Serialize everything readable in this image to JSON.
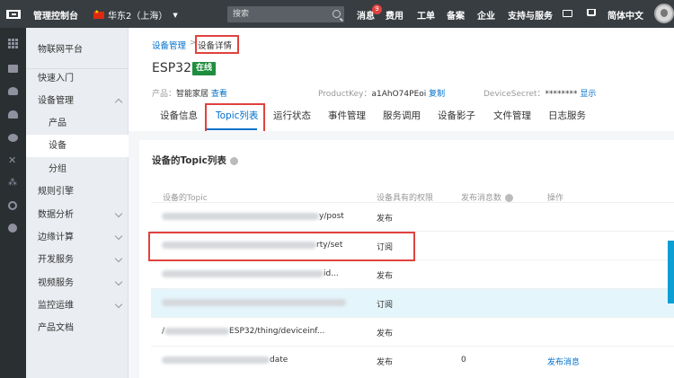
{
  "topbar": {
    "console_title": "管理控制台",
    "region": "华东2（上海）",
    "search_placeholder": "搜索",
    "messages_label": "消息",
    "messages_count": "9",
    "nav": [
      "费用",
      "工单",
      "备案",
      "企业",
      "支持与服务"
    ],
    "language": "简体中文"
  },
  "sidebar": {
    "title": "物联网平台",
    "items": [
      {
        "label": "快速入门"
      },
      {
        "label": "设备管理"
      },
      {
        "label": "产品"
      },
      {
        "label": "设备"
      },
      {
        "label": "分组"
      },
      {
        "label": "规则引擎"
      },
      {
        "label": "数据分析"
      },
      {
        "label": "边缘计算"
      },
      {
        "label": "开发服务"
      },
      {
        "label": "视频服务"
      },
      {
        "label": "监控运维"
      },
      {
        "label": "产品文档"
      }
    ]
  },
  "breadcrumb": {
    "parent": "设备管理",
    "separator": ">",
    "current": "设备详情"
  },
  "device": {
    "name": "ESP32",
    "status": "在线",
    "product_label": "产品：",
    "product_value": "智能家居",
    "product_link": "查看",
    "productkey_label": "ProductKey：",
    "productkey_value": "a1AhO74PEoi",
    "productkey_link": "复制",
    "secret_label": "DeviceSecret：",
    "secret_value": "********",
    "secret_link": "显示"
  },
  "tabs": [
    "设备信息",
    "Topic列表",
    "运行状态",
    "事件管理",
    "服务调用",
    "设备影子",
    "文件管理",
    "日志服务"
  ],
  "topic_table": {
    "title": "设备的Topic列表",
    "headers": [
      "设备的Topic",
      "设备具有的权限",
      "发布消息数",
      "操作"
    ],
    "rows": [
      {
        "topic_visible": "/a1AhO74PEoi/ESP32/....../post",
        "topic_start": "",
        "topic_end": "y/post",
        "permission": "发布",
        "count": "",
        "action": ""
      },
      {
        "topic_visible": "/....../property/set",
        "topic_start": "",
        "topic_end": "rty/set",
        "permission": "订阅",
        "count": "",
        "action": ""
      },
      {
        "topic_visible": "...",
        "topic_start": "",
        "topic_end": "id...",
        "permission": "发布",
        "count": "",
        "action": ""
      },
      {
        "topic_visible": "",
        "topic_start": "",
        "topic_end": "",
        "permission": "订阅",
        "count": "",
        "action": ""
      },
      {
        "topic_visible": "/......ESP32/thing/deviceinf......",
        "topic_start": "/",
        "topic_end": "ESP32/thing/deviceinf...",
        "permission": "发布",
        "count": "",
        "action": ""
      },
      {
        "topic_visible": "/......PEoi......date",
        "topic_start": "",
        "topic_end": "date",
        "permission": "发布",
        "count": "0",
        "action": "发布消息"
      }
    ]
  },
  "colors": {
    "topbar_bg": "#373d41",
    "accent": "#0070cc",
    "online_green": "#1e8e3e",
    "highlight_red": "#e0423e",
    "row_highlight": "#e4f5fb"
  }
}
